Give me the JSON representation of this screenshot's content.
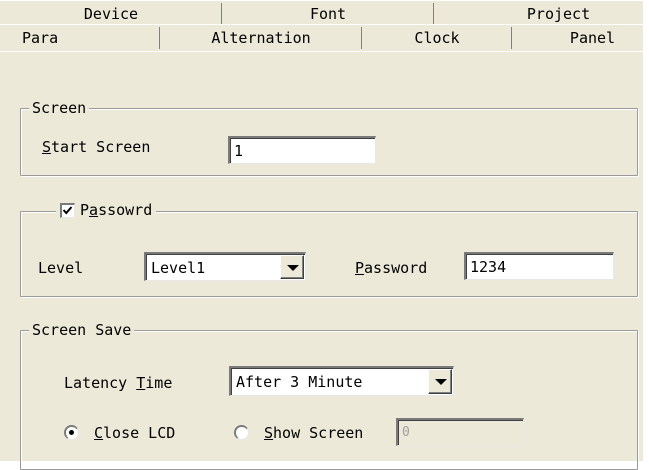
{
  "tabs_back": [
    "Device",
    "Font",
    "Project"
  ],
  "tabs_front": [
    "Para",
    "Alternation",
    "Clock",
    "Panel"
  ],
  "screen_group": {
    "legend": "Screen",
    "start_screen_label_u": "S",
    "start_screen_label_rest": "tart Screen",
    "start_screen_value": "1"
  },
  "password_group": {
    "checkbox_checked": true,
    "legend_pre": "P",
    "legend_u": "a",
    "legend_rest": "ssowrd",
    "level_label": "Level",
    "level_value": "Level1",
    "password_label_u": "P",
    "password_label_rest": "assword",
    "password_value": "1234"
  },
  "screen_save_group": {
    "legend": "Screen Save",
    "latency_label_pre": "Latency ",
    "latency_label_u": "T",
    "latency_label_rest": "ime",
    "latency_value": "After 3 Minute",
    "close_lcd_u": "C",
    "close_lcd_rest": "lose LCD",
    "close_lcd_selected": true,
    "show_screen_u": "S",
    "show_screen_rest": "how Screen",
    "show_screen_value": "0"
  },
  "icons": {
    "checkbox": "check-mark-icon",
    "combo": "chevron-down-icon"
  }
}
